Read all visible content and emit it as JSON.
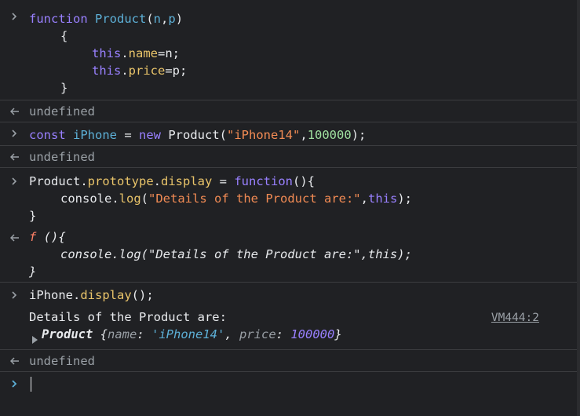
{
  "entries": {
    "func_def": {
      "l1_kw": "function",
      "l1_name": "Product",
      "l1_params_open": "(",
      "l1_n": "n",
      "l1_comma": ",",
      "l1_p": "p",
      "l1_params_close": ")",
      "l2": "{",
      "l3_this": "this",
      "l3_dot": ".",
      "l3_prop": "name",
      "l3_rest": "=n;",
      "l4_this": "this",
      "l4_dot": ".",
      "l4_prop": "price",
      "l4_rest": "=p;",
      "l5": "}",
      "result": "undefined"
    },
    "const_def": {
      "kw": "const",
      "var": "iPhone",
      "eq": " = ",
      "new_kw": "new",
      "ctor": " Product(",
      "str": "\"iPhone14\"",
      "comma": ",",
      "num": "100000",
      "close": ");",
      "result": "undefined"
    },
    "proto_def": {
      "l1_obj": "Product",
      "l1_dot1": ".",
      "l1_proto": "prototype",
      "l1_dot2": ".",
      "l1_method": "display",
      "l1_eq": " = ",
      "l1_fn": "function",
      "l1_rest": "(){",
      "l2_console": "console",
      "l2_dot": ".",
      "l2_log": "log",
      "l2_open": "(",
      "l2_str": "\"Details of the Product are:\"",
      "l2_comma": ",",
      "l2_this": "this",
      "l2_close": ");",
      "l3": "}",
      "res_f": "f",
      "res_l1_rest": " (){",
      "res_l2": "console.log(\"Details of the Product are:\",this);",
      "res_l3": "}"
    },
    "call": {
      "obj": "iPhone",
      "dot": ".",
      "method": "display",
      "rest": "();",
      "log_text": "Details of the Product are:",
      "source": "VM444:2",
      "obj_name": "Product",
      "obj_open": " {",
      "key_name": "name",
      "colon1": ": ",
      "val_name": "'iPhone14'",
      "sep": ", ",
      "key_price": "price",
      "colon2": ": ",
      "val_price": "100000",
      "obj_close": "}",
      "result": "undefined"
    }
  },
  "icons": {
    "input_prompt": "chevron-right-icon",
    "result_arrow": "return-arrow-icon",
    "expand": "expand-triangle-icon"
  },
  "colors": {
    "background": "#202124",
    "divider": "#3c3d40",
    "keyword": "#9980ff",
    "string": "#f28b54",
    "property": "#e9c46a",
    "identifier": "#5db0d7",
    "muted": "#9aa0a6"
  }
}
